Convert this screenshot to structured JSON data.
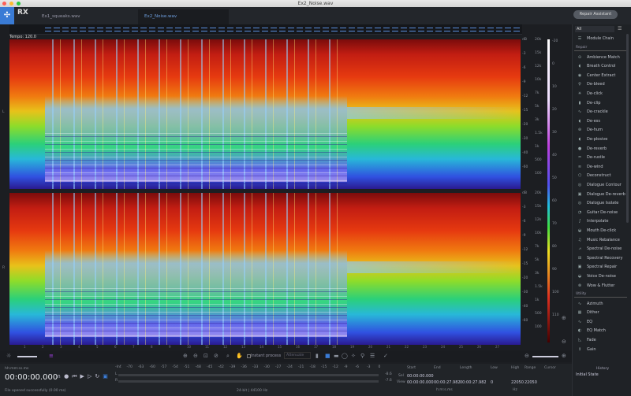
{
  "window": {
    "title": "Ex2_Noise.wav"
  },
  "app": {
    "logo": "RX",
    "tabs": [
      {
        "label": "Ex1_squeaks.wav",
        "active": false
      },
      {
        "label": "Ex2_Noise.wav",
        "active": true
      }
    ],
    "repair_assistant": "Repair Assistant"
  },
  "editor": {
    "tempo": "Tempo: 120.0",
    "channels": [
      "L",
      "R"
    ]
  },
  "colors": {
    "accent": "#3a7bd5",
    "background": "#1c1e22"
  },
  "freq_scale": {
    "db_labels": [
      "dB",
      "-3",
      "-6",
      "-9",
      "-12",
      "-15",
      "-20",
      "-30",
      "-40",
      "-60"
    ],
    "hz_labels": [
      "20k",
      "15k",
      "12k",
      "10k",
      "7k",
      "5k",
      "3k",
      "1.5k",
      "1k",
      "500",
      "100"
    ]
  },
  "colorbar_labels": [
    "-20",
    "0",
    "10",
    "20",
    "30",
    "40",
    "50",
    "60",
    "70",
    "80",
    "90",
    "100",
    "110"
  ],
  "ruler": {
    "ticks": [
      "1",
      "2",
      "3",
      "4",
      "5",
      "6",
      "7",
      "8",
      "9",
      "10",
      "11",
      "12",
      "13",
      "14",
      "15",
      "16",
      "17",
      "18",
      "19",
      "20",
      "21",
      "22",
      "23",
      "24",
      "25",
      "26",
      "27"
    ]
  },
  "toolbar": {
    "instant_process": "Instant process",
    "mode": "Attenuate",
    "instant_process_checked": false
  },
  "transport": {
    "time_format": "hh:mm:ss.ms",
    "time": "00:00:00.000",
    "status": "File opened successfully (0.00 ms)",
    "format": "24-bit | 44100 Hz"
  },
  "meter": {
    "scale": [
      "-Inf.",
      "-70",
      "-63",
      "-60",
      "-57",
      "-54",
      "-51",
      "-48",
      "-45",
      "-42",
      "-39",
      "-36",
      "-33",
      "-30",
      "-27",
      "-24",
      "-21",
      "-18",
      "-15",
      "-12",
      "-9",
      "-6",
      "-3",
      "0"
    ],
    "L": "-8.6",
    "R": "-7.6",
    "channels": [
      "L",
      "R"
    ]
  },
  "selection": {
    "headers": [
      "Start",
      "End",
      "Length",
      "Low",
      "High",
      "Range",
      "Cursor"
    ],
    "sel_label": "Sel",
    "view_label": "View",
    "sel": {
      "start": "00:00:00.000"
    },
    "view": {
      "start": "00:00:00.000",
      "end": "00:00:27.982",
      "length": "00:00:27.982",
      "low": "0",
      "high": "22050",
      "range": "22050"
    },
    "time_unit": "h:m:s.ms",
    "freq_unit": "Hz"
  },
  "modules": {
    "filter": "All",
    "module_chain": "Module Chain",
    "repair_section": "Repair",
    "repair": [
      {
        "label": "Ambience Match",
        "icon": "⊙"
      },
      {
        "label": "Breath Control",
        "icon": "◖"
      },
      {
        "label": "Center Extract",
        "icon": "◉"
      },
      {
        "label": "De-bleed",
        "icon": "♀"
      },
      {
        "label": "De-click",
        "icon": "✳"
      },
      {
        "label": "De-clip",
        "icon": "▮"
      },
      {
        "label": "De-crackle",
        "icon": "∿"
      },
      {
        "label": "De-ess",
        "icon": "◖"
      },
      {
        "label": "De-hum",
        "icon": "⊛"
      },
      {
        "label": "De-plosive",
        "icon": "◖"
      },
      {
        "label": "De-reverb",
        "icon": "●"
      },
      {
        "label": "De-rustle",
        "icon": "♒"
      },
      {
        "label": "De-wind",
        "icon": "≋"
      },
      {
        "label": "Deconstruct",
        "icon": "⬡"
      },
      {
        "label": "Dialogue Contour",
        "icon": "◎"
      },
      {
        "label": "Dialogue De-reverb",
        "icon": "▣"
      },
      {
        "label": "Dialogue Isolate",
        "icon": "◎"
      },
      {
        "label": "Guitar De-noise",
        "icon": "◔"
      },
      {
        "label": "Interpolate",
        "icon": "∫"
      },
      {
        "label": "Mouth De-click",
        "icon": "◒"
      },
      {
        "label": "Music Rebalance",
        "icon": "♫"
      },
      {
        "label": "Spectral De-noise",
        "icon": "⩘"
      },
      {
        "label": "Spectral Recovery",
        "icon": "⊞"
      },
      {
        "label": "Spectral Repair",
        "icon": "▣"
      },
      {
        "label": "Voice De-noise",
        "icon": "◒"
      },
      {
        "label": "Wow & Flutter",
        "icon": "⊗"
      }
    ],
    "utility_section": "Utility",
    "utility": [
      {
        "label": "Azimuth",
        "icon": "∿"
      },
      {
        "label": "Dither",
        "icon": "▦"
      },
      {
        "label": "EQ",
        "icon": "∿"
      },
      {
        "label": "EQ Match",
        "icon": "◐"
      },
      {
        "label": "Fade",
        "icon": "◺"
      },
      {
        "label": "Gain",
        "icon": "↕"
      }
    ]
  },
  "history": {
    "title": "History",
    "items": [
      "Initial State"
    ]
  }
}
